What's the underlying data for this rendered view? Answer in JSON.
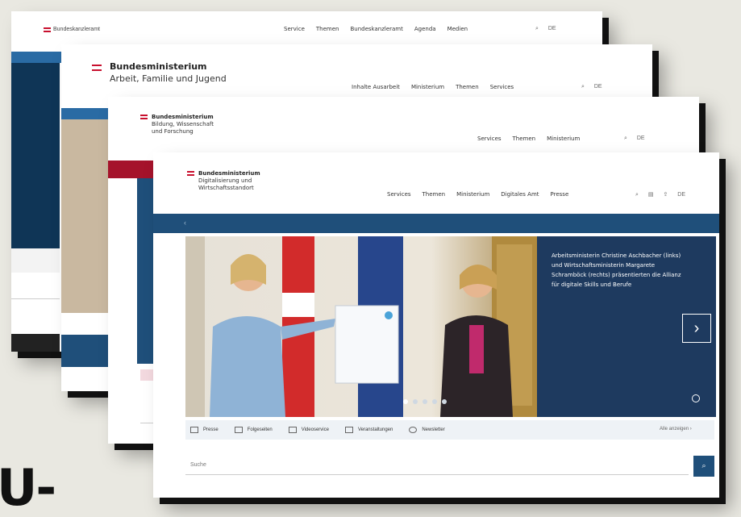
{
  "corner_text": "U-",
  "windows": [
    {
      "id": "w1",
      "brand": "Bundeskanzleramt",
      "nav": [
        "Service",
        "Themen",
        "Bundeskanzleramt",
        "Agenda",
        "Medien"
      ],
      "lang": "DE",
      "colors": {
        "bar": "#2a6ba4"
      }
    },
    {
      "id": "w2",
      "title": "Bundesministerium",
      "subtitle": "Arbeit, Familie und Jugend",
      "nav": [
        "Inhalte Ausarbeit",
        "Ministerium",
        "Themen",
        "Services"
      ],
      "lang": "DE",
      "colors": {
        "bar": "#2a6ba4"
      }
    },
    {
      "id": "w3",
      "title": "Bundesministerium",
      "subtitle_line1": "Bildung, Wissenschaft",
      "subtitle_line2": "und Forschung",
      "nav": [
        "Services",
        "Themen",
        "Ministerium"
      ],
      "lang": "DE",
      "colors": {
        "bar": "#a5132b"
      }
    },
    {
      "id": "w4",
      "title": "Bundesministerium",
      "subtitle_line1": "Digitalisierung und",
      "subtitle_line2": "Wirtschaftsstandort",
      "nav": [
        "Services",
        "Themen",
        "Ministerium",
        "Digitales Amt",
        "Presse"
      ],
      "lang": "DE",
      "hero_caption": "Arbeitsministerin Christine Aschbacher (links) und Wirtschaftsministerin Margarete Schramböck (rechts) präsentierten die Allianz für digitale Skills und Berufe",
      "quicklinks": [
        "Presse",
        "Folgeseiten",
        "Videoservice",
        "Veranstaltungen",
        "Newsletter"
      ],
      "quicklinks_more": "Alle anzeigen",
      "search_placeholder": "Suche",
      "colors": {
        "bar": "#1f4f7a",
        "panel": "#1e3a5f"
      }
    }
  ]
}
